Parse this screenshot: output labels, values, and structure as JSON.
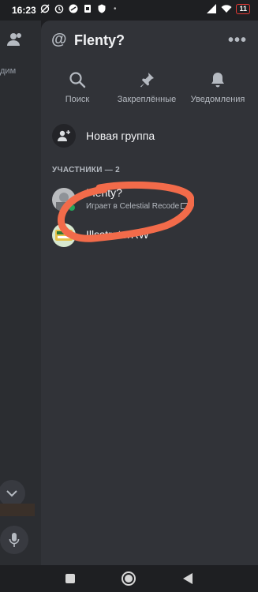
{
  "status_bar": {
    "time": "16:23",
    "battery": "11",
    "icons": [
      "sync-off-icon",
      "alarm-icon",
      "vpn-icon",
      "clipboard-icon",
      "shield-icon"
    ],
    "right_icons": [
      "signal-icon",
      "wifi-icon",
      "battery-icon"
    ]
  },
  "left_pane": {
    "partial_text": "дим",
    "icons": [
      "people-icon",
      "chevron-down-icon",
      "microphone-icon"
    ]
  },
  "header": {
    "at_symbol": "@",
    "title": "Flenty?",
    "more_icon": "more-icon"
  },
  "actions": [
    {
      "label": "Поиск",
      "icon": "search-icon"
    },
    {
      "label": "Закреплённые",
      "icon": "pin-icon"
    },
    {
      "label": "Уведомления",
      "icon": "bell-icon"
    }
  ],
  "new_group": {
    "label": "Новая группа",
    "icon": "add-user-icon"
  },
  "members_header": "УЧАСТНИКИ — 2",
  "members": [
    {
      "name": "Flenty?",
      "activity": "Играет в Celestial Recode",
      "status": "online",
      "status_color": "#23a55a"
    },
    {
      "name": "IllsstratorRW",
      "activity": ""
    }
  ],
  "annotation": {
    "color": "#f26b4a",
    "shape": "freehand-ellipse"
  },
  "colors": {
    "panel_bg": "#313338",
    "left_bg": "#2b2d31",
    "app_bg": "#1e1f22",
    "text_primary": "#f2f3f5",
    "text_muted": "#b5bac1",
    "online": "#23a55a"
  },
  "nav_bar": {
    "icons": [
      "recent-apps-icon",
      "home-icon",
      "back-icon"
    ]
  }
}
